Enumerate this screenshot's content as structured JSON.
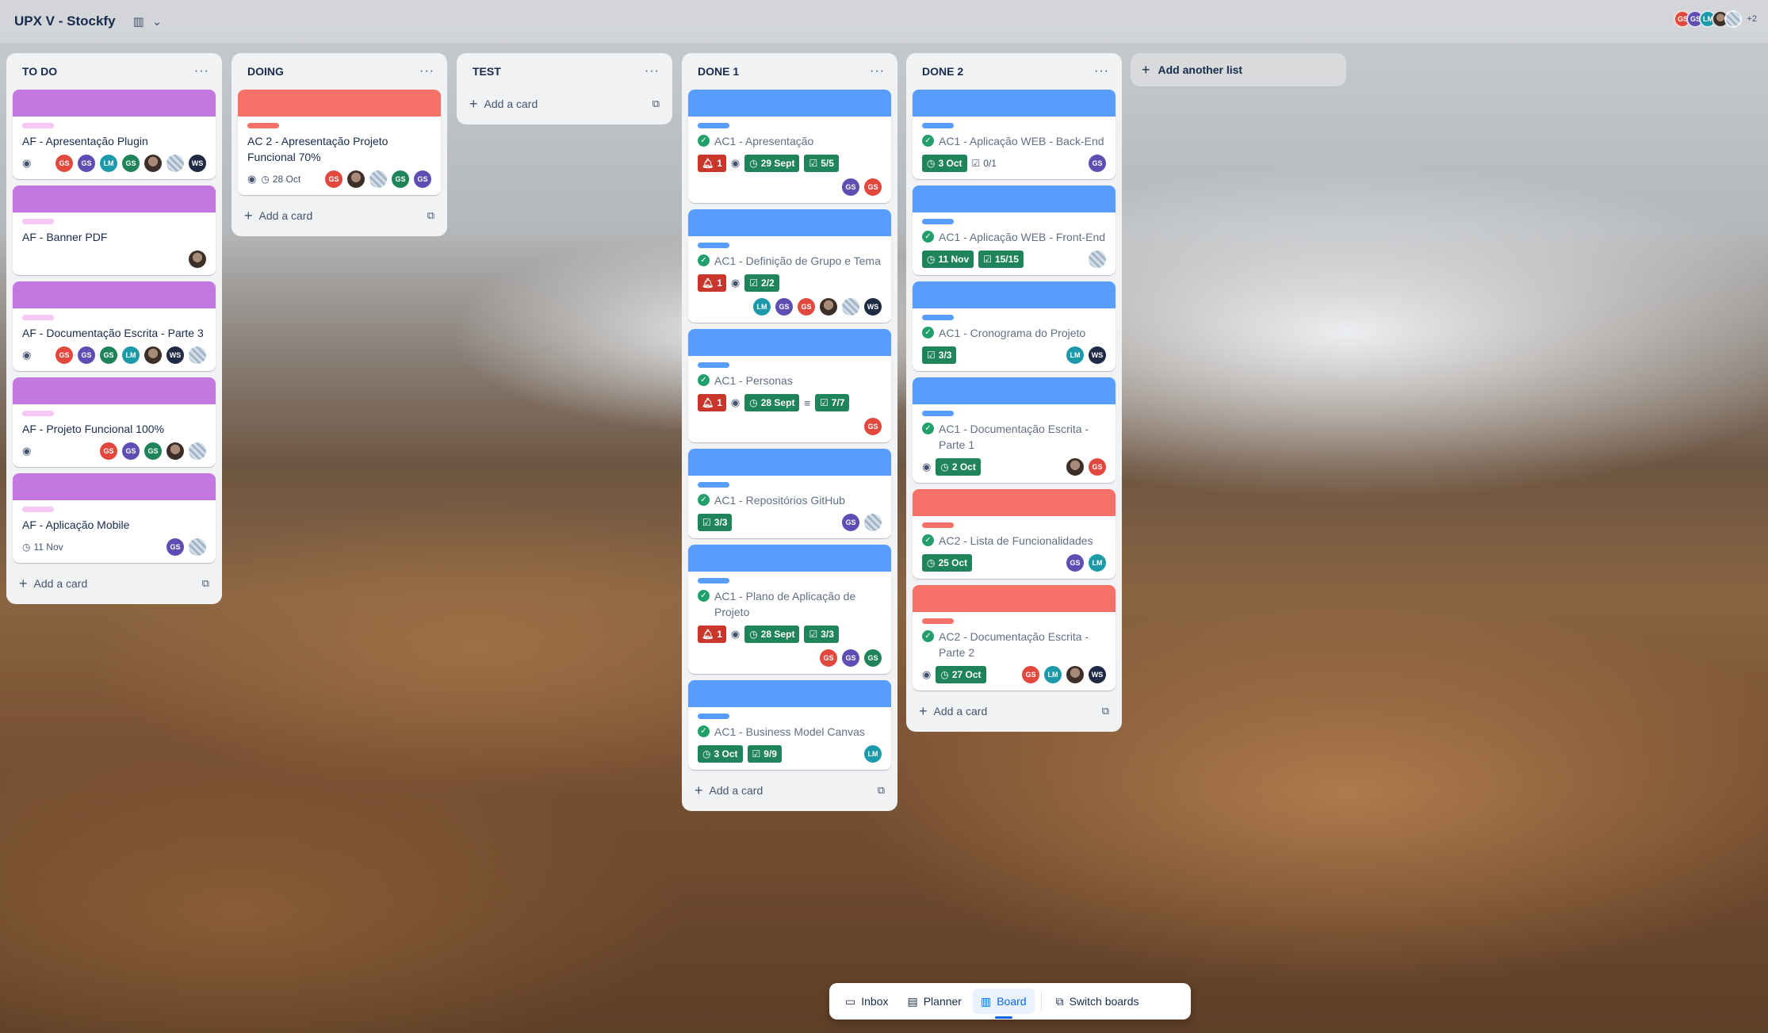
{
  "board": {
    "title": "UPX V - Stockfy",
    "view_icon": "board-view-icon",
    "more_members": "+2"
  },
  "lists": [
    {
      "title": "TO DO",
      "add_card": "Add a card",
      "cards": [
        {
          "title": "AF - Apresentação Plugin",
          "cover": "purple",
          "label": "pink"
        },
        {
          "title": "AF - Banner PDF",
          "cover": "purple",
          "label": "pink"
        },
        {
          "title": "AF - Documentação Escrita - Parte 3",
          "cover": "purple",
          "label": "pink"
        },
        {
          "title": "AF - Projeto Funcional 100%",
          "cover": "purple",
          "label": "pink"
        },
        {
          "title": "AF - Aplicação Mobile",
          "cover": "purple",
          "label": "pink",
          "due": "11 Nov"
        }
      ]
    },
    {
      "title": "DOING",
      "add_card": "Add a card",
      "cards": [
        {
          "title": "AC 2 - Apresentação Projeto Funcional 70%",
          "cover": "red",
          "label": "red",
          "due": "28 Oct"
        }
      ]
    },
    {
      "title": "TEST",
      "add_card": "Add a card",
      "cards": []
    },
    {
      "title": "DONE 1",
      "add_card": "Add a card",
      "cards": [
        {
          "title": "AC1 - Apresentação",
          "alerts": "1",
          "due": "29 Sept",
          "checklist": "5/5"
        },
        {
          "title": "AC1 - Definição de Grupo e Tema",
          "alerts": "1",
          "checklist": "2/2"
        },
        {
          "title": "AC1 - Personas",
          "alerts": "1",
          "due": "28 Sept",
          "checklist": "7/7"
        },
        {
          "title": "AC1 - Repositórios GitHub",
          "checklist": "3/3"
        },
        {
          "title": "AC1 - Plano de Aplicação de Projeto",
          "alerts": "1",
          "due": "28 Sept",
          "checklist": "3/3"
        },
        {
          "title": "AC1 - Business Model Canvas",
          "due": "3 Oct",
          "checklist": "9/9"
        }
      ]
    },
    {
      "title": "DONE 2",
      "add_card": "Add a card",
      "cards": [
        {
          "title": "AC1 - Aplicação WEB - Back-End",
          "due": "3 Oct",
          "checklist": "0/1"
        },
        {
          "title": "AC1 - Aplicação WEB - Front-End",
          "due": "11 Nov",
          "checklist": "15/15"
        },
        {
          "title": "AC1 - Cronograma do Projeto",
          "checklist": "3/3"
        },
        {
          "title": "AC1 - Documentação Escrita - Parte 1",
          "due": "2 Oct"
        },
        {
          "title": "AC2 - Lista de Funcionalidades",
          "due": "25 Oct"
        },
        {
          "title": "AC2 - Documentação Escrita - Parte 2",
          "due": "27 Oct"
        }
      ]
    }
  ],
  "add_list": "Add another list",
  "bottom_nav": {
    "inbox": "Inbox",
    "planner": "Planner",
    "board": "Board",
    "switch": "Switch boards"
  },
  "avatar_initials": {
    "gs": "GS",
    "lm": "LM",
    "ws": "WS"
  },
  "colors": {
    "purple_cover": "#c377e0",
    "red_cover": "#f87168",
    "blue_cover": "#579dff",
    "complete_green": "#1f845a",
    "alert_red": "#c9372c"
  }
}
